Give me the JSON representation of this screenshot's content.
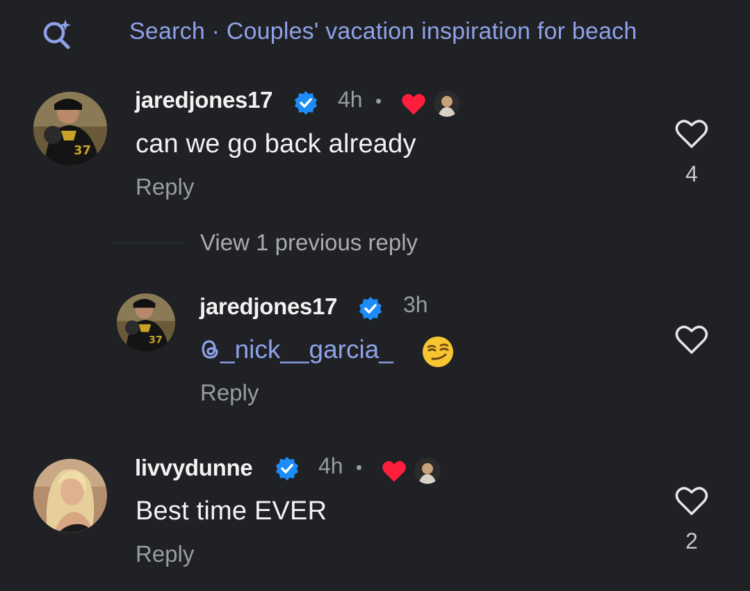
{
  "search": {
    "text": "Search · Couples' vacation inspiration for beach"
  },
  "comments": [
    {
      "username": "jaredjones17",
      "time": "4h",
      "separator": "•",
      "text": "can we go back already",
      "reply_label": "Reply",
      "likes": "4"
    },
    {
      "username": "livvydunne",
      "time": "4h",
      "separator": "•",
      "text": "Best time EVER",
      "reply_label": "Reply",
      "likes": "2"
    }
  ],
  "view_replies_label": "View 1 previous reply",
  "reply": {
    "username": "jaredjones17",
    "time": "3h",
    "mention": "_nick__garcia_",
    "reply_label": "Reply"
  },
  "colors": {
    "background": "#1f2125",
    "link": "#8fa2e8",
    "verified": "#1d8cf8",
    "heart": "#ff1f3d",
    "muted": "#9a9ca3"
  },
  "icons": {
    "search": "search-sparkle-icon",
    "verified": "verified-badge-icon",
    "liked": "heart-filled-icon",
    "like": "heart-outline-icon",
    "emoji": "smirking-face-emoji"
  }
}
